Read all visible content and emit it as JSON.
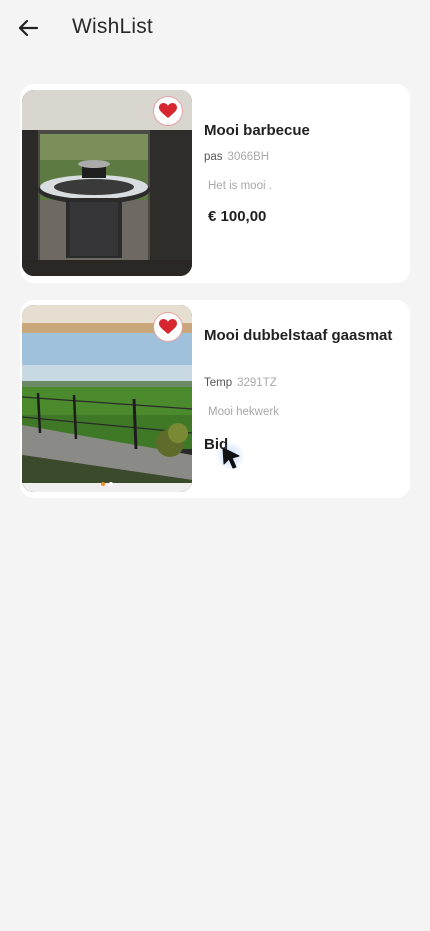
{
  "header": {
    "title": "WishList",
    "back_icon": "arrow-left-icon"
  },
  "wishlist": [
    {
      "title": "Mooi barbecue",
      "city": "pas",
      "zip": "3066BH",
      "description": "Het is mooi .",
      "price": "€ 100,00",
      "favorite": true,
      "image": "barbecue-grill-photo"
    },
    {
      "title": "Mooi dubbelstaaf gaasmat",
      "city": "Temp",
      "zip": "3291TZ",
      "description": "Mooi hekwerk",
      "price_label": "Bid",
      "favorite": true,
      "image": "fence-field-photo",
      "carousel_dots": 2,
      "carousel_active": 0
    }
  ],
  "colors": {
    "background": "#f4f4f4",
    "card": "#ffffff",
    "heart": "#d6262f",
    "dot_active": "#f08a24"
  }
}
